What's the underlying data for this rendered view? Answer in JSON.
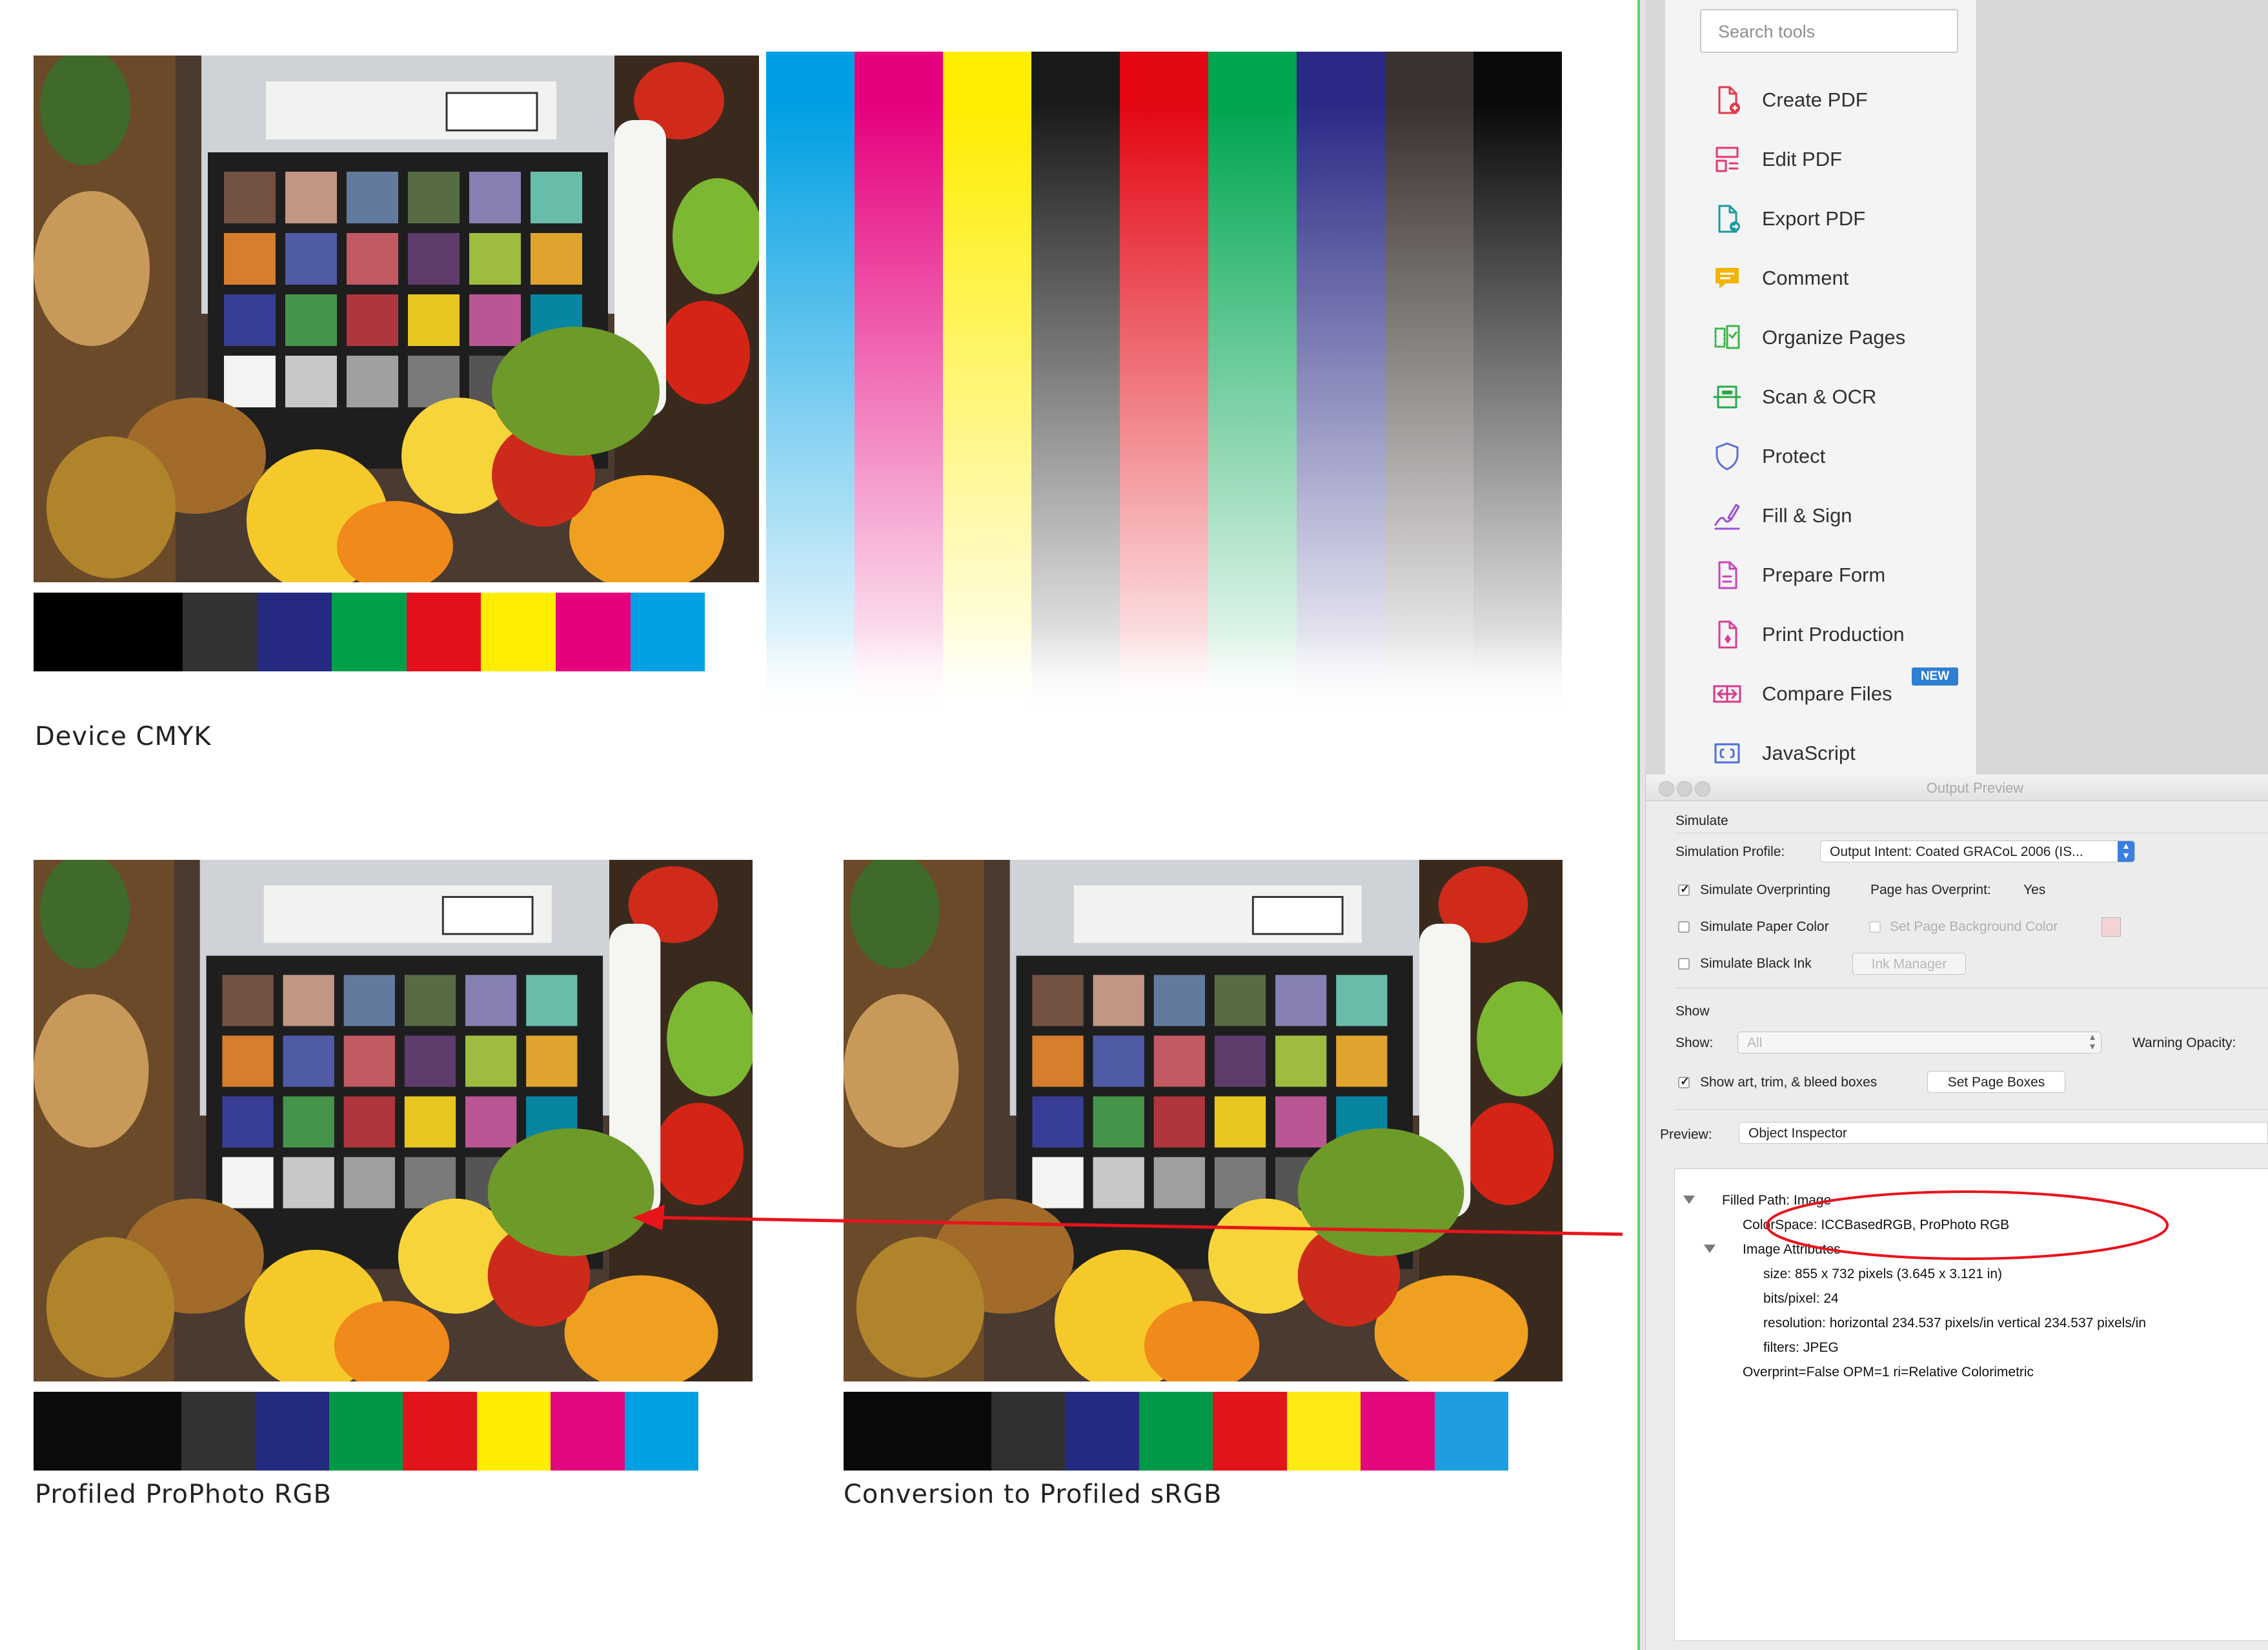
{
  "document": {
    "captions": {
      "device_cmyk": "Device CMYK",
      "prophoto": "Profiled ProPhoto RGB",
      "srgb": "Conversion to Profiled sRGB"
    },
    "swatch_colors_cmyk": [
      "#000000",
      "#000000",
      "#333333",
      "#252a80",
      "#00a04a",
      "#e3101c",
      "#ffed00",
      "#e5007e",
      "#00a0e3"
    ],
    "swatch_colors_prophoto": [
      "#0c0c0c",
      "#0c0c0c",
      "#333333",
      "#232b7e",
      "#009847",
      "#e2141b",
      "#ffec00",
      "#e3077f",
      "#00a0e2"
    ],
    "swatch_colors_srgb": [
      "#0a0a0a",
      "#0a0a0a",
      "#303030",
      "#232b82",
      "#00994a",
      "#e3131c",
      "#fcea12",
      "#e5087d",
      "#1e9ee0"
    ],
    "ramp_colors": [
      "#009fe3",
      "#e6007e",
      "#ffed00",
      "#1a1a1a",
      "#e30613",
      "#00a551",
      "#2a2a86",
      "#3a3230",
      "#0a0a0a"
    ]
  },
  "tools": {
    "search_placeholder": "Search tools",
    "items": [
      {
        "label": "Create PDF",
        "icon": "create-pdf-icon",
        "color": "#e3384a"
      },
      {
        "label": "Edit PDF",
        "icon": "edit-pdf-icon",
        "color": "#e5376f"
      },
      {
        "label": "Export PDF",
        "icon": "export-pdf-icon",
        "color": "#1a9aa0"
      },
      {
        "label": "Comment",
        "icon": "comment-icon",
        "color": "#f2b400"
      },
      {
        "label": "Organize Pages",
        "icon": "organize-pages-icon",
        "color": "#39b54a"
      },
      {
        "label": "Scan & OCR",
        "icon": "scan-ocr-icon",
        "color": "#2aa84a"
      },
      {
        "label": "Protect",
        "icon": "protect-icon",
        "color": "#5b6fd6"
      },
      {
        "label": "Fill & Sign",
        "icon": "fill-sign-icon",
        "color": "#9b4fd0"
      },
      {
        "label": "Prepare Form",
        "icon": "prepare-form-icon",
        "color": "#c844b8"
      },
      {
        "label": "Print Production",
        "icon": "print-production-icon",
        "color": "#d83f97"
      },
      {
        "label": "Compare Files",
        "icon": "compare-files-icon",
        "color": "#d8378a"
      },
      {
        "label": "JavaScript",
        "icon": "javascript-icon",
        "color": "#4d6fd6"
      }
    ],
    "new_badge": "NEW"
  },
  "output_preview": {
    "title": "Output Preview",
    "simulate_header": "Simulate",
    "simulation_profile_label": "Simulation Profile:",
    "simulation_profile_value": "Output Intent: Coated GRACoL 2006 (IS...",
    "simulate_overprinting_label": "Simulate Overprinting",
    "simulate_overprinting_checked": true,
    "page_has_overprint_label": "Page has Overprint:",
    "page_has_overprint_value": "Yes",
    "simulate_paper_color_label": "Simulate Paper Color",
    "set_page_bg_label": "Set Page Background Color",
    "simulate_black_ink_label": "Simulate Black Ink",
    "ink_manager_label": "Ink Manager",
    "show_header": "Show",
    "show_label": "Show:",
    "show_value": "All",
    "warning_opacity_label": "Warning Opacity:",
    "show_boxes_label": "Show art, trim, & bleed boxes",
    "show_boxes_checked": true,
    "set_page_boxes_label": "Set Page Boxes",
    "preview_label": "Preview:",
    "preview_value": "Object Inspector",
    "inspector": {
      "filled_path": "Filled Path: Image",
      "colorspace": "ColorSpace: ICCBasedRGB, ProPhoto RGB",
      "image_attributes": "Image Attributes",
      "size": "size: 855 x 732 pixels (3.645 x 3.121 in)",
      "bits": "bits/pixel: 24",
      "resolution": "resolution: horizontal 234.537 pixels/in vertical 234.537 pixels/in",
      "filters": "filters: JPEG",
      "overprint": "Overprint=False OPM=1 ri=Relative Colorimetric"
    },
    "annotation_color": "#e8141c"
  }
}
